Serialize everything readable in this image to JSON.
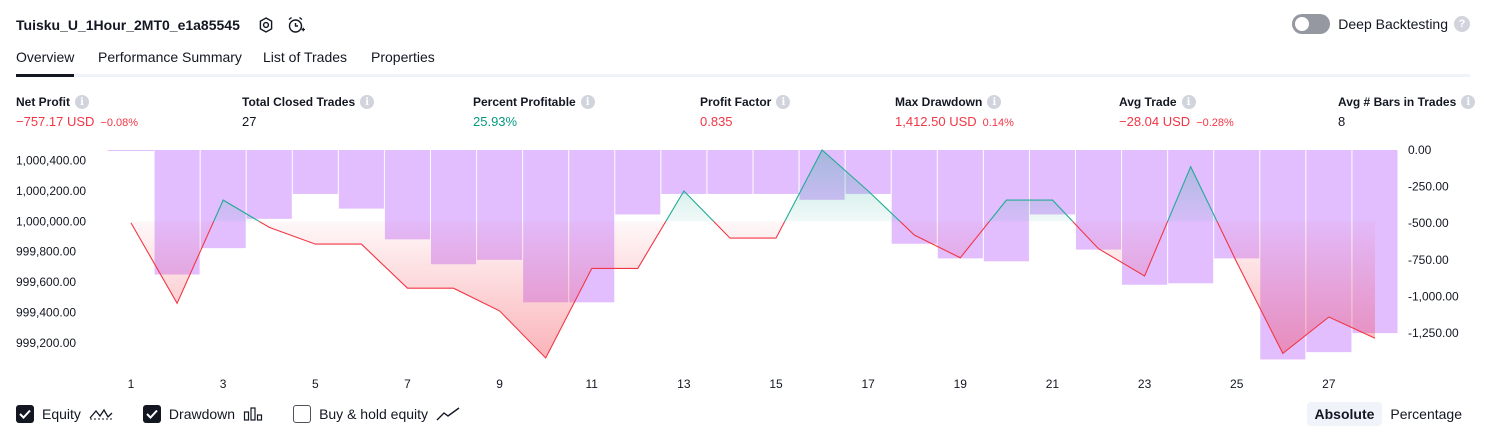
{
  "header": {
    "strategy_title": "Tuisku_U_1Hour_2MT0_e1a85545",
    "deep_backtesting_label": "Deep Backtesting",
    "help_glyph": "?"
  },
  "tabs": [
    {
      "label": "Overview",
      "active": true
    },
    {
      "label": "Performance Summary",
      "active": false
    },
    {
      "label": "List of Trades",
      "active": false
    },
    {
      "label": "Properties",
      "active": false
    }
  ],
  "info_glyph": "i",
  "metrics": [
    {
      "label": "Net Profit",
      "value": "−757.17 USD",
      "sub": "−0.08%",
      "tone": "red"
    },
    {
      "label": "Total Closed Trades",
      "value": "27",
      "sub": "",
      "tone": "dark"
    },
    {
      "label": "Percent Profitable",
      "value": "25.93%",
      "sub": "",
      "tone": "green"
    },
    {
      "label": "Profit Factor",
      "value": "0.835",
      "sub": "",
      "tone": "red"
    },
    {
      "label": "Max Drawdown",
      "value": "1,412.50 USD",
      "sub": "0.14%",
      "tone": "red"
    },
    {
      "label": "Avg Trade",
      "value": "−28.04 USD",
      "sub": "−0.28%",
      "tone": "red"
    },
    {
      "label": "Avg # Bars in Trades",
      "value": "8",
      "sub": "",
      "tone": "dark"
    }
  ],
  "chart_data": {
    "type": "line",
    "x_tick_labels": [
      "1",
      "3",
      "5",
      "7",
      "9",
      "11",
      "13",
      "15",
      "17",
      "19",
      "21",
      "23",
      "25",
      "27"
    ],
    "y_left_ticks": [
      "1,000,400.00",
      "1,000,200.00",
      "1,000,000.00",
      "999,800.00",
      "999,600.00",
      "999,400.00",
      "999,200.00"
    ],
    "y_right_ticks": [
      "0.00",
      "-250.00",
      "-500.00",
      "-750.00",
      "-1,000.00",
      "-1,250.00"
    ],
    "y_left_range": [
      999100,
      1000470
    ],
    "y_right_range": [
      -1420,
      0
    ],
    "equity_baseline": 1000000,
    "equity": [
      999990,
      999460,
      1000140,
      999960,
      999850,
      999850,
      999560,
      999560,
      999410,
      999100,
      999690,
      999690,
      1000200,
      999890,
      999890,
      1000470,
      1000200,
      999910,
      999760,
      1000140,
      1000140,
      999820,
      999640,
      1000360,
      999730,
      999130,
      999370,
      999230
    ],
    "drawdown": [
      0,
      -850,
      -670,
      -470,
      -300,
      -400,
      -610,
      -780,
      -750,
      -1040,
      -1040,
      -440,
      -300,
      -300,
      -300,
      -340,
      -300,
      -640,
      -740,
      -760,
      -440,
      -680,
      -920,
      -910,
      -740,
      -1430,
      -1380,
      -1250
    ],
    "colors": {
      "equity_up": "#22ab94",
      "equity_down": "#f23645",
      "drawdown_bar": "#ce93ff",
      "text": "#131722"
    }
  },
  "legend": {
    "items": [
      {
        "label": "Equity",
        "checked": true,
        "icon": "equity-line-icon"
      },
      {
        "label": "Drawdown",
        "checked": true,
        "icon": "drawdown-bars-icon"
      },
      {
        "label": "Buy & hold equity",
        "checked": false,
        "icon": "buy-hold-line-icon"
      }
    ],
    "modes": [
      {
        "label": "Absolute",
        "active": true
      },
      {
        "label": "Percentage",
        "active": false
      }
    ]
  }
}
